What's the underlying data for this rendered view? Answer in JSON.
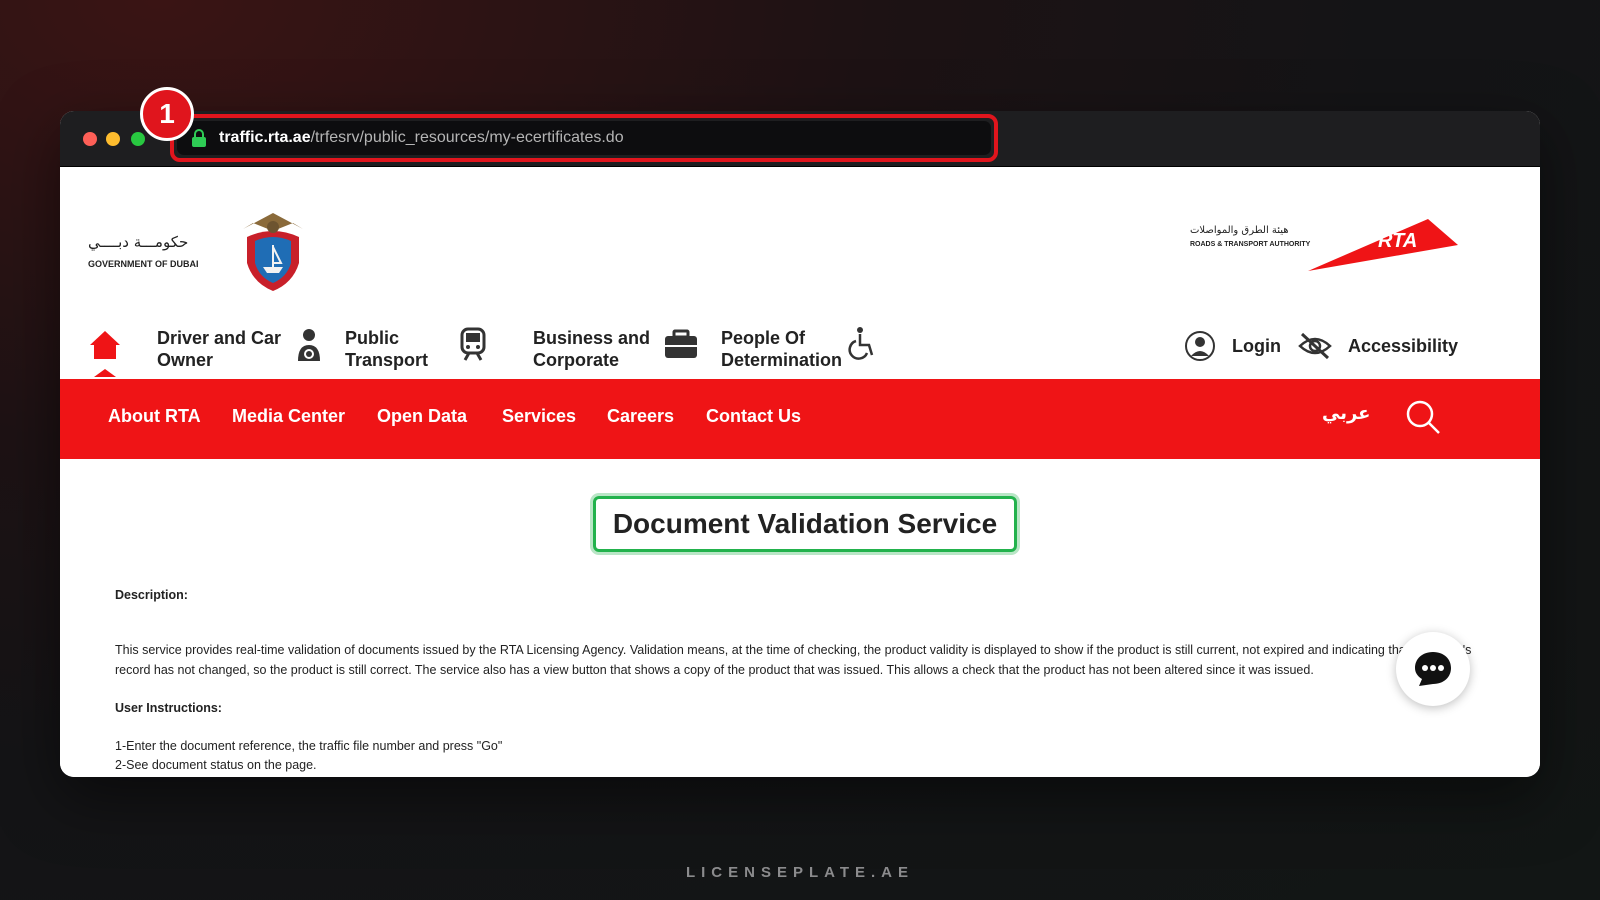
{
  "browser": {
    "url_host": "traffic.rta.ae",
    "url_path": "/trfesrv/public_resources/my-ecertificates.do",
    "step_badge": "1"
  },
  "header": {
    "gov_logo_arabic": "حكومـــة دبــــي",
    "gov_logo_english": "GOVERNMENT OF DUBAI",
    "rta_logo_arabic": "هيئة الطرق والمواصلات",
    "rta_logo_english": "ROADS & TRANSPORT AUTHORITY",
    "rta_logo_mark": "RTA"
  },
  "topnav": {
    "items": [
      {
        "line1": "Driver and Car",
        "line2": "Owner",
        "icon": "person-icon"
      },
      {
        "line1": "Public",
        "line2": "Transport",
        "icon": "train-icon"
      },
      {
        "line1": "Business and",
        "line2": "Corporate",
        "icon": "briefcase-icon"
      },
      {
        "line1": "People Of",
        "line2": "Determination",
        "icon": "wheelchair-icon"
      }
    ],
    "login": "Login",
    "accessibility": "Accessibility"
  },
  "menu": {
    "items": [
      "About RTA",
      "Media Center",
      "Open Data",
      "Services",
      "Careers",
      "Contact Us"
    ],
    "arabic": "عربي"
  },
  "main": {
    "title": "Document Validation Service",
    "description_label": "Description:",
    "description_text": "This service provides real-time validation of documents issued by the RTA Licensing Agency. Validation means, at the time of checking, the product validity is displayed to show if the product is still current, not expired and indicating that the client's record has not changed, so the product is still correct. The service also has a view button that shows a copy of the product that was issued. This allows a check that the product has not been altered since it was issued.",
    "instructions_label": "User Instructions:",
    "instructions": [
      "1-Enter the document reference, the traffic file number and press \"Go\"",
      "2-See document status on the page."
    ]
  },
  "footer": {
    "brand": "LICENSEPLATE.AE"
  },
  "colors": {
    "rta_red": "#ef1416",
    "highlight_green": "#22b24c",
    "annotation_red": "#e0151d"
  }
}
